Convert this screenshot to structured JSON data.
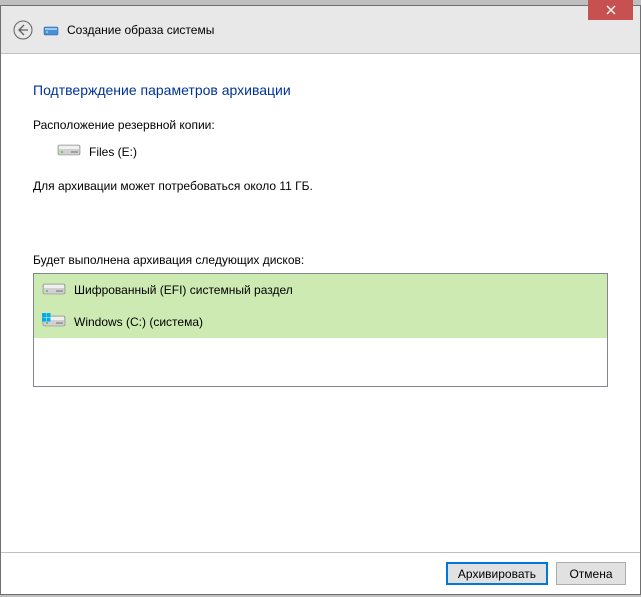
{
  "titlebar": {
    "title": "Создание образа системы"
  },
  "content": {
    "heading": "Подтверждение параметров архивации",
    "location_label": "Расположение резервной копии:",
    "destination": "Files (E:)",
    "size_estimate": "Для архивации может потребоваться около 11 ГБ.",
    "disks_label": "Будет выполнена архивация следующих дисков:",
    "disks": [
      {
        "label": "Шифрованный (EFI) системный раздел"
      },
      {
        "label": "Windows (C:) (система)"
      }
    ]
  },
  "buttons": {
    "archive": "Архивировать",
    "cancel": "Отмена"
  }
}
